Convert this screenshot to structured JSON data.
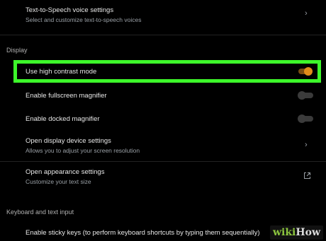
{
  "tts_settings": {
    "title": "Text-to-Speech voice settings",
    "subtitle": "Select and customize text-to-speech voices"
  },
  "display": {
    "section_title": "Display",
    "high_contrast": {
      "label": "Use high contrast mode",
      "enabled": true
    },
    "fullscreen_magnifier": {
      "label": "Enable fullscreen magnifier",
      "enabled": false
    },
    "docked_magnifier": {
      "label": "Enable docked magnifier",
      "enabled": false
    },
    "display_device": {
      "title": "Open display device settings",
      "subtitle": "Allows you to adjust your screen resolution"
    },
    "appearance": {
      "title": "Open appearance settings",
      "subtitle": "Customize your text size"
    }
  },
  "keyboard": {
    "section_title": "Keyboard and text input",
    "sticky_keys": {
      "label": "Enable sticky keys (to perform keyboard shortcuts by typing them sequentially)"
    }
  },
  "watermark": {
    "wiki": "wiki",
    "how": "How"
  },
  "colors": {
    "accent": "#e08c1a",
    "highlight_border": "#3df82a"
  }
}
